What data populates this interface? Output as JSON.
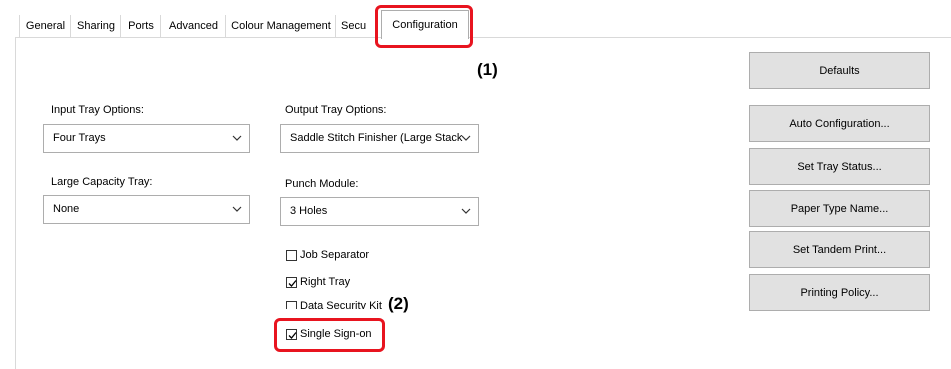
{
  "tabs": [
    {
      "label": "General"
    },
    {
      "label": "Sharing"
    },
    {
      "label": "Ports"
    },
    {
      "label": "Advanced"
    },
    {
      "label": "Colour Management"
    },
    {
      "label": "Secu"
    },
    {
      "label": "Configuration",
      "active": true
    }
  ],
  "annotations": {
    "one": "(1)",
    "two": "(2)"
  },
  "left": {
    "input_tray": {
      "label": "Input Tray Options:",
      "value": "Four Trays"
    },
    "large_capacity": {
      "label": "Large Capacity Tray:",
      "value": "None"
    }
  },
  "middle": {
    "output_tray": {
      "label": "Output Tray Options:",
      "value": "Saddle Stitch Finisher (Large Stack"
    },
    "punch": {
      "label": "Punch Module:",
      "value": "3 Holes"
    },
    "checkboxes": [
      {
        "label": "Job Separator",
        "checked": false
      },
      {
        "label": "Right Tray",
        "checked": true
      },
      {
        "label": "Data Security Kit",
        "checked": false
      },
      {
        "label": "Single Sign-on",
        "checked": true
      }
    ]
  },
  "right": {
    "defaults": "Defaults",
    "auto_config": "Auto Configuration...",
    "tray_status": "Set Tray Status...",
    "paper_type": "Paper Type Name...",
    "tandem": "Set Tandem Print...",
    "policy": "Printing Policy..."
  },
  "colors": {
    "highlight": "#e8141f",
    "button_bg": "#e1e1e1"
  },
  "icons": {
    "combo_arrow": "chevron-down-icon",
    "checkmark": "checkmark-icon"
  }
}
